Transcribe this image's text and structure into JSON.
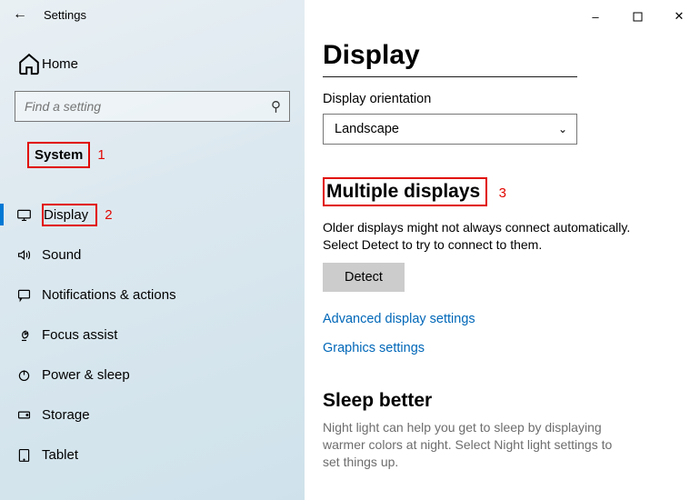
{
  "window": {
    "title": "Settings"
  },
  "home": {
    "label": "Home"
  },
  "search": {
    "placeholder": "Find a setting"
  },
  "category": {
    "label": "System"
  },
  "nav": {
    "items": [
      {
        "label": "Display"
      },
      {
        "label": "Sound"
      },
      {
        "label": "Notifications & actions"
      },
      {
        "label": "Focus assist"
      },
      {
        "label": "Power & sleep"
      },
      {
        "label": "Storage"
      },
      {
        "label": "Tablet"
      }
    ]
  },
  "annotations": {
    "system_num": "1",
    "display_num": "2",
    "multiple_num": "3"
  },
  "main": {
    "title": "Display",
    "orientation": {
      "label": "Display orientation",
      "value": "Landscape"
    },
    "multiple": {
      "heading": "Multiple displays",
      "text": "Older displays might not always connect automatically. Select Detect to try to connect to them.",
      "detect": "Detect"
    },
    "links": {
      "advanced": "Advanced display settings",
      "graphics": "Graphics settings"
    },
    "sleep": {
      "heading": "Sleep better",
      "text": "Night light can help you get to sleep by displaying warmer colors at night. Select Night light settings to set things up."
    }
  }
}
